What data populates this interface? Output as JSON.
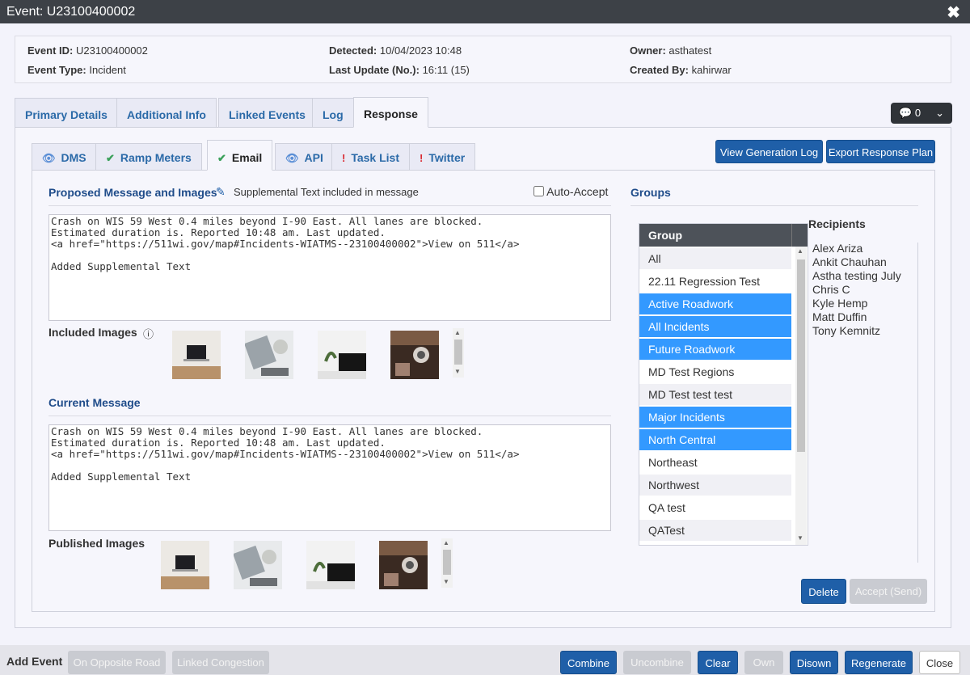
{
  "window": {
    "title": "Event: U23100400002",
    "close_icon": "✖"
  },
  "event_info": {
    "event_id_label": "Event ID:",
    "event_id": "U23100400002",
    "event_type_label": "Event Type:",
    "event_type": "Incident",
    "detected_label": "Detected:",
    "detected": "10/04/2023 10:48",
    "last_update_label": "Last Update (No.):",
    "last_update": "16:11 (15)",
    "owner_label": "Owner:",
    "owner": "asthatest",
    "created_by_label": "Created By:",
    "created_by": "kahirwar"
  },
  "main_tabs": [
    "Primary Details",
    "Additional Info",
    "Linked Events",
    "Log",
    "Response"
  ],
  "messages": {
    "count": "0",
    "icon": "speech-bubble-icon"
  },
  "sub_tabs": [
    {
      "label": "DMS",
      "icon": "eye"
    },
    {
      "label": "Ramp Meters",
      "icon": "check"
    },
    {
      "label": "Email",
      "icon": "check"
    },
    {
      "label": "API",
      "icon": "eye"
    },
    {
      "label": "Task List",
      "icon": "bang"
    },
    {
      "label": "Twitter",
      "icon": "bang"
    }
  ],
  "buttons": {
    "view_generation_log": "View Generation Log",
    "export_response_plan": "Export Response Plan",
    "delete": "Delete",
    "accept_send": "Accept (Send)"
  },
  "proposed": {
    "heading": "Proposed Message and Images",
    "supplemental_note": "Supplemental Text included in message",
    "auto_accept_label": "Auto-Accept",
    "text": "Crash on WIS 59 West 0.4 miles beyond I-90 East. All lanes are blocked.\nEstimated duration is. Reported 10:48 am. Last updated.\n<a href=\"https://511wi.gov/map#Incidents-WIATMS--23100400002\">View on 511</a>\n\nAdded Supplemental Text",
    "images_label": "Included Images"
  },
  "current": {
    "heading": "Current Message",
    "text": "Crash on WIS 59 West 0.4 miles beyond I-90 East. All lanes are blocked.\nEstimated duration is. Reported 10:48 am. Last updated.\n<a href=\"https://511wi.gov/map#Incidents-WIATMS--23100400002\">View on 511</a>\n\nAdded Supplemental Text",
    "images_label": "Published Images"
  },
  "groups": {
    "heading": "Groups",
    "column": "Group",
    "items": [
      {
        "name": "All",
        "selected": false
      },
      {
        "name": "22.11 Regression Test",
        "selected": false
      },
      {
        "name": "Active Roadwork",
        "selected": true
      },
      {
        "name": "All Incidents",
        "selected": true
      },
      {
        "name": "Future Roadwork",
        "selected": true
      },
      {
        "name": "MD Test Regions",
        "selected": false
      },
      {
        "name": "MD Test test test",
        "selected": false
      },
      {
        "name": "Major Incidents",
        "selected": true
      },
      {
        "name": "North Central",
        "selected": true
      },
      {
        "name": "Northeast",
        "selected": false
      },
      {
        "name": "Northwest",
        "selected": false
      },
      {
        "name": "QA test",
        "selected": false
      },
      {
        "name": "QATest",
        "selected": false
      }
    ]
  },
  "recipients": {
    "heading": "Recipients",
    "names": [
      "Alex Ariza",
      "Ankit Chauhan",
      "Astha testing July",
      "Chris C",
      "Kyle Hemp",
      "Matt Duffin",
      "Tony Kemnitz"
    ]
  },
  "bottom": {
    "add_event": "Add Event",
    "on_opposite_road": "On Opposite Road",
    "linked_congestion": "Linked Congestion",
    "combine": "Combine",
    "uncombine": "Uncombine",
    "clear": "Clear",
    "own": "Own",
    "disown": "Disown",
    "regenerate": "Regenerate",
    "close": "Close"
  }
}
